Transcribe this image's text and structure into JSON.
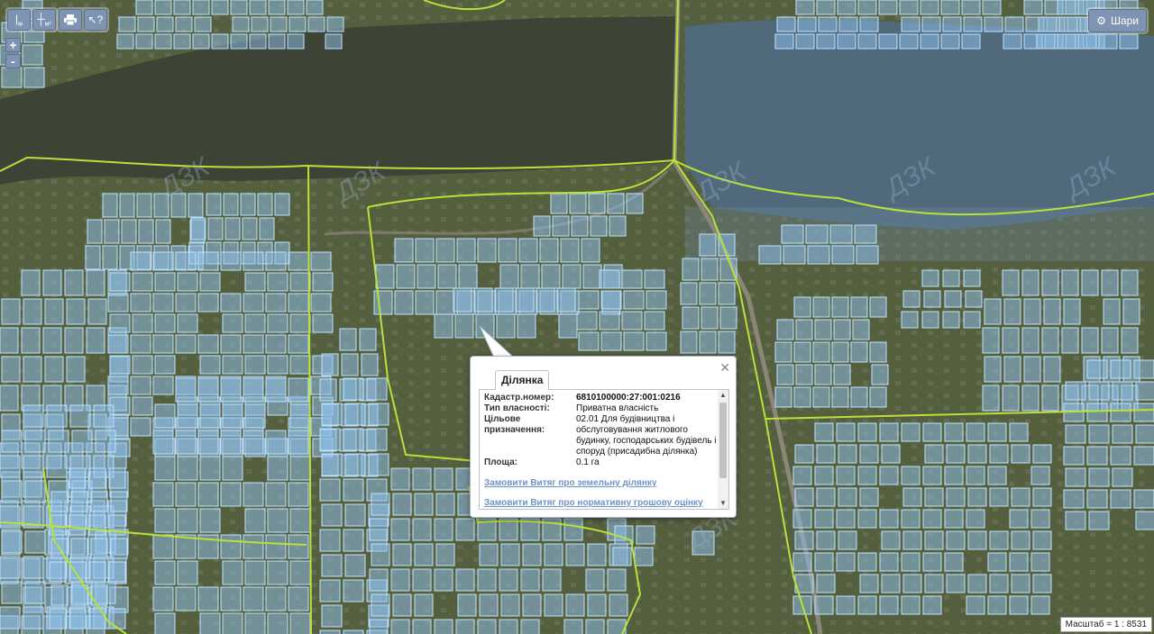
{
  "toolbar": {
    "left_group": [
      {
        "name": "measure-line-button",
        "icon": "ruler-line-icon",
        "label": "м"
      },
      {
        "name": "measure-area-button",
        "icon": "ruler-area-icon",
        "label": "м²"
      }
    ],
    "right_group": [
      {
        "name": "print-button",
        "icon": "printer-icon"
      },
      {
        "name": "identify-button",
        "icon": "pointer-question-icon"
      }
    ]
  },
  "zoom": {
    "in": "+",
    "out": "-"
  },
  "layers_button": {
    "label": "Шари",
    "icon": "gear-icon"
  },
  "watermark": "ДЗК",
  "popup": {
    "tab": "Ділянка",
    "fields": [
      {
        "key": "Кадастр.номер:",
        "value": "6810100000:27:001:0216",
        "bold": true
      },
      {
        "key": "Тип власності:",
        "value": "Приватна власність"
      },
      {
        "key": "Цільове призначення:",
        "value": "02.01 Для будівництва і обслуговування житлового будинку, господарських будівель і споруд (присадибна ділянка)"
      },
      {
        "key": "Площа:",
        "value": "0.1 га"
      }
    ],
    "links": [
      "Замовити Витяг про земельну ділянку",
      "Замовити Витяг про нормативну грошову оцінку"
    ]
  },
  "scale": "Масштаб = 1 : 8531",
  "colors": {
    "parcel_fill": "#8fc1ee",
    "parcel_stroke": "#bfe3ff",
    "boundary": "#b8e23a",
    "water_left": "#3f4536",
    "water_right": "#4c6272",
    "ground": "#525c3c"
  }
}
